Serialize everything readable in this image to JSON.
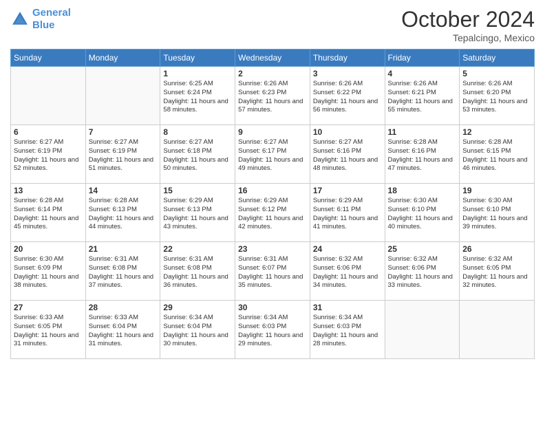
{
  "header": {
    "logo_line1": "General",
    "logo_line2": "Blue",
    "month": "October 2024",
    "location": "Tepalcingo, Mexico"
  },
  "weekdays": [
    "Sunday",
    "Monday",
    "Tuesday",
    "Wednesday",
    "Thursday",
    "Friday",
    "Saturday"
  ],
  "weeks": [
    [
      {
        "day": "",
        "sunrise": "",
        "sunset": "",
        "daylight": ""
      },
      {
        "day": "",
        "sunrise": "",
        "sunset": "",
        "daylight": ""
      },
      {
        "day": "1",
        "sunrise": "Sunrise: 6:25 AM",
        "sunset": "Sunset: 6:24 PM",
        "daylight": "Daylight: 11 hours and 58 minutes."
      },
      {
        "day": "2",
        "sunrise": "Sunrise: 6:26 AM",
        "sunset": "Sunset: 6:23 PM",
        "daylight": "Daylight: 11 hours and 57 minutes."
      },
      {
        "day": "3",
        "sunrise": "Sunrise: 6:26 AM",
        "sunset": "Sunset: 6:22 PM",
        "daylight": "Daylight: 11 hours and 56 minutes."
      },
      {
        "day": "4",
        "sunrise": "Sunrise: 6:26 AM",
        "sunset": "Sunset: 6:21 PM",
        "daylight": "Daylight: 11 hours and 55 minutes."
      },
      {
        "day": "5",
        "sunrise": "Sunrise: 6:26 AM",
        "sunset": "Sunset: 6:20 PM",
        "daylight": "Daylight: 11 hours and 53 minutes."
      }
    ],
    [
      {
        "day": "6",
        "sunrise": "Sunrise: 6:27 AM",
        "sunset": "Sunset: 6:19 PM",
        "daylight": "Daylight: 11 hours and 52 minutes."
      },
      {
        "day": "7",
        "sunrise": "Sunrise: 6:27 AM",
        "sunset": "Sunset: 6:19 PM",
        "daylight": "Daylight: 11 hours and 51 minutes."
      },
      {
        "day": "8",
        "sunrise": "Sunrise: 6:27 AM",
        "sunset": "Sunset: 6:18 PM",
        "daylight": "Daylight: 11 hours and 50 minutes."
      },
      {
        "day": "9",
        "sunrise": "Sunrise: 6:27 AM",
        "sunset": "Sunset: 6:17 PM",
        "daylight": "Daylight: 11 hours and 49 minutes."
      },
      {
        "day": "10",
        "sunrise": "Sunrise: 6:27 AM",
        "sunset": "Sunset: 6:16 PM",
        "daylight": "Daylight: 11 hours and 48 minutes."
      },
      {
        "day": "11",
        "sunrise": "Sunrise: 6:28 AM",
        "sunset": "Sunset: 6:16 PM",
        "daylight": "Daylight: 11 hours and 47 minutes."
      },
      {
        "day": "12",
        "sunrise": "Sunrise: 6:28 AM",
        "sunset": "Sunset: 6:15 PM",
        "daylight": "Daylight: 11 hours and 46 minutes."
      }
    ],
    [
      {
        "day": "13",
        "sunrise": "Sunrise: 6:28 AM",
        "sunset": "Sunset: 6:14 PM",
        "daylight": "Daylight: 11 hours and 45 minutes."
      },
      {
        "day": "14",
        "sunrise": "Sunrise: 6:28 AM",
        "sunset": "Sunset: 6:13 PM",
        "daylight": "Daylight: 11 hours and 44 minutes."
      },
      {
        "day": "15",
        "sunrise": "Sunrise: 6:29 AM",
        "sunset": "Sunset: 6:13 PM",
        "daylight": "Daylight: 11 hours and 43 minutes."
      },
      {
        "day": "16",
        "sunrise": "Sunrise: 6:29 AM",
        "sunset": "Sunset: 6:12 PM",
        "daylight": "Daylight: 11 hours and 42 minutes."
      },
      {
        "day": "17",
        "sunrise": "Sunrise: 6:29 AM",
        "sunset": "Sunset: 6:11 PM",
        "daylight": "Daylight: 11 hours and 41 minutes."
      },
      {
        "day": "18",
        "sunrise": "Sunrise: 6:30 AM",
        "sunset": "Sunset: 6:10 PM",
        "daylight": "Daylight: 11 hours and 40 minutes."
      },
      {
        "day": "19",
        "sunrise": "Sunrise: 6:30 AM",
        "sunset": "Sunset: 6:10 PM",
        "daylight": "Daylight: 11 hours and 39 minutes."
      }
    ],
    [
      {
        "day": "20",
        "sunrise": "Sunrise: 6:30 AM",
        "sunset": "Sunset: 6:09 PM",
        "daylight": "Daylight: 11 hours and 38 minutes."
      },
      {
        "day": "21",
        "sunrise": "Sunrise: 6:31 AM",
        "sunset": "Sunset: 6:08 PM",
        "daylight": "Daylight: 11 hours and 37 minutes."
      },
      {
        "day": "22",
        "sunrise": "Sunrise: 6:31 AM",
        "sunset": "Sunset: 6:08 PM",
        "daylight": "Daylight: 11 hours and 36 minutes."
      },
      {
        "day": "23",
        "sunrise": "Sunrise: 6:31 AM",
        "sunset": "Sunset: 6:07 PM",
        "daylight": "Daylight: 11 hours and 35 minutes."
      },
      {
        "day": "24",
        "sunrise": "Sunrise: 6:32 AM",
        "sunset": "Sunset: 6:06 PM",
        "daylight": "Daylight: 11 hours and 34 minutes."
      },
      {
        "day": "25",
        "sunrise": "Sunrise: 6:32 AM",
        "sunset": "Sunset: 6:06 PM",
        "daylight": "Daylight: 11 hours and 33 minutes."
      },
      {
        "day": "26",
        "sunrise": "Sunrise: 6:32 AM",
        "sunset": "Sunset: 6:05 PM",
        "daylight": "Daylight: 11 hours and 32 minutes."
      }
    ],
    [
      {
        "day": "27",
        "sunrise": "Sunrise: 6:33 AM",
        "sunset": "Sunset: 6:05 PM",
        "daylight": "Daylight: 11 hours and 31 minutes."
      },
      {
        "day": "28",
        "sunrise": "Sunrise: 6:33 AM",
        "sunset": "Sunset: 6:04 PM",
        "daylight": "Daylight: 11 hours and 31 minutes."
      },
      {
        "day": "29",
        "sunrise": "Sunrise: 6:34 AM",
        "sunset": "Sunset: 6:04 PM",
        "daylight": "Daylight: 11 hours and 30 minutes."
      },
      {
        "day": "30",
        "sunrise": "Sunrise: 6:34 AM",
        "sunset": "Sunset: 6:03 PM",
        "daylight": "Daylight: 11 hours and 29 minutes."
      },
      {
        "day": "31",
        "sunrise": "Sunrise: 6:34 AM",
        "sunset": "Sunset: 6:03 PM",
        "daylight": "Daylight: 11 hours and 28 minutes."
      },
      {
        "day": "",
        "sunrise": "",
        "sunset": "",
        "daylight": ""
      },
      {
        "day": "",
        "sunrise": "",
        "sunset": "",
        "daylight": ""
      }
    ]
  ]
}
